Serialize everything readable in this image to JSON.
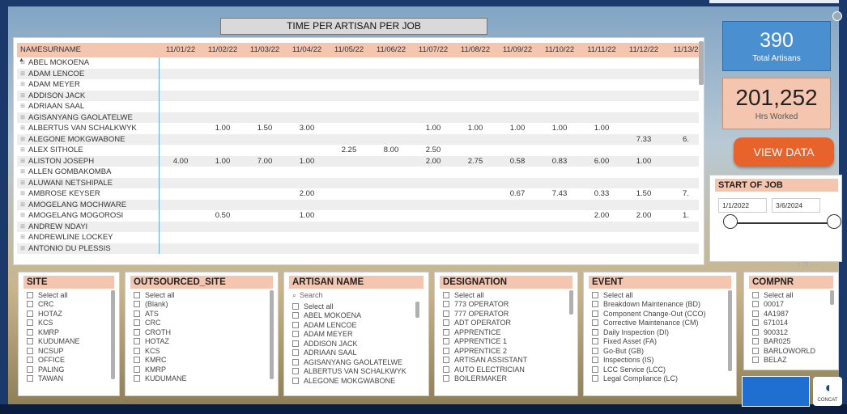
{
  "matrix": {
    "title": "TIME PER ARTISAN PER JOB",
    "name_header": "NAMESURNAME",
    "dates": [
      "11/01/22",
      "11/02/22",
      "11/03/22",
      "11/04/22",
      "11/05/22",
      "11/06/22",
      "11/07/22",
      "11/08/22",
      "11/09/22",
      "11/10/22",
      "11/11/22",
      "11/12/22",
      "11/13/2"
    ],
    "rows": [
      {
        "name": "ABEL MOKOENA",
        "cells": [
          "",
          "",
          "",
          "",
          "",
          "",
          "",
          "",
          "",
          "",
          "",
          "",
          ""
        ]
      },
      {
        "name": "ADAM LENCOE",
        "cells": [
          "",
          "",
          "",
          "",
          "",
          "",
          "",
          "",
          "",
          "",
          "",
          "",
          ""
        ]
      },
      {
        "name": "ADAM MEYER",
        "cells": [
          "",
          "",
          "",
          "",
          "",
          "",
          "",
          "",
          "",
          "",
          "",
          "",
          ""
        ]
      },
      {
        "name": "ADDISON JACK",
        "cells": [
          "",
          "",
          "",
          "",
          "",
          "",
          "",
          "",
          "",
          "",
          "",
          "",
          ""
        ]
      },
      {
        "name": "ADRIAAN SAAL",
        "cells": [
          "",
          "",
          "",
          "",
          "",
          "",
          "",
          "",
          "",
          "",
          "",
          "",
          ""
        ]
      },
      {
        "name": "AGISANYANG GAOLATELWE",
        "cells": [
          "",
          "",
          "",
          "",
          "",
          "",
          "",
          "",
          "",
          "",
          "",
          "",
          ""
        ]
      },
      {
        "name": "ALBERTUS VAN SCHALKWYK",
        "cells": [
          "",
          "1.00",
          "1.50",
          "3.00",
          "",
          "",
          "1.00",
          "1.00",
          "1.00",
          "1.00",
          "1.00",
          "",
          ""
        ]
      },
      {
        "name": "ALEGONE MOKGWABONE",
        "cells": [
          "",
          "",
          "",
          "",
          "",
          "",
          "",
          "",
          "",
          "",
          "",
          "7.33",
          "6."
        ]
      },
      {
        "name": "ALEX SITHOLE",
        "cells": [
          "",
          "",
          "",
          "",
          "2.25",
          "8.00",
          "2.50",
          "",
          "",
          "",
          "",
          "",
          ""
        ]
      },
      {
        "name": "ALISTON JOSEPH",
        "cells": [
          "4.00",
          "1.00",
          "7.00",
          "1.00",
          "",
          "",
          "2.00",
          "2.75",
          "0.58",
          "0.83",
          "6.00",
          "1.00",
          ""
        ]
      },
      {
        "name": "ALLEN GOMBAKOMBA",
        "cells": [
          "",
          "",
          "",
          "",
          "",
          "",
          "",
          "",
          "",
          "",
          "",
          "",
          ""
        ]
      },
      {
        "name": "ALUWANI NETSHIPALE",
        "cells": [
          "",
          "",
          "",
          "",
          "",
          "",
          "",
          "",
          "",
          "",
          "",
          "",
          ""
        ]
      },
      {
        "name": "AMBROSE KEYSER",
        "cells": [
          "",
          "",
          "",
          "2.00",
          "",
          "",
          "",
          "",
          "0.67",
          "7.43",
          "0.33",
          "1.50",
          "7."
        ]
      },
      {
        "name": "AMOGELANG MOCHWARE",
        "cells": [
          "",
          "",
          "",
          "",
          "",
          "",
          "",
          "",
          "",
          "",
          "",
          "",
          ""
        ]
      },
      {
        "name": "AMOGELANG MOGOROSI",
        "cells": [
          "",
          "0.50",
          "",
          "1.00",
          "",
          "",
          "",
          "",
          "",
          "",
          "2.00",
          "2.00",
          "1."
        ]
      },
      {
        "name": "ANDREW NDAYI",
        "cells": [
          "",
          "",
          "",
          "",
          "",
          "",
          "",
          "",
          "",
          "",
          "",
          "",
          ""
        ]
      },
      {
        "name": "ANDREWLINE LOCKEY",
        "cells": [
          "",
          "",
          "",
          "",
          "",
          "",
          "",
          "",
          "",
          "",
          "",
          "",
          ""
        ]
      },
      {
        "name": "ANTONIO DU PLESSIS",
        "cells": [
          "",
          "",
          "",
          "",
          "",
          "",
          "",
          "",
          "",
          "",
          "",
          "",
          ""
        ]
      }
    ]
  },
  "kpi": {
    "artisans_value": "390",
    "artisans_label": "Total Artisans",
    "hours_value": "201,252",
    "hours_label": "Hrs Worked"
  },
  "view_button": "VIEW DATA",
  "date_slicer": {
    "title": "START OF JOB",
    "start": "1/1/2022",
    "end": "3/6/2024"
  },
  "slicers": {
    "site": {
      "title": "SITE",
      "items": [
        "Select all",
        "CRC",
        "HOTAZ",
        "KCS",
        "KMRP",
        "KUDUMANE",
        "NCSUP",
        "OFFICE",
        "PALING",
        "TAWAN"
      ]
    },
    "outsourced": {
      "title": "OUTSOURCED_SITE",
      "items": [
        "Select all",
        "(Blank)",
        "ATS",
        "CRC",
        "CROTH",
        "HOTAZ",
        "KCS",
        "KMRC",
        "KMRP",
        "KUDUMANE"
      ]
    },
    "artisan": {
      "title": "ARTISAN NAME",
      "search_placeholder": "Search",
      "items": [
        "Select all",
        "ABEL MOKOENA",
        "ADAM LENCOE",
        "ADAM MEYER",
        "ADDISON JACK",
        "ADRIAAN SAAL",
        "AGISANYANG GAOLATELWE",
        "ALBERTUS VAN SCHALKWYK",
        "ALEGONE MOKGWABONE"
      ]
    },
    "designation": {
      "title": "DESIGNATION",
      "items": [
        "Select all",
        "773 OPERATOR",
        "777 OPERATOR",
        "ADT OPERATOR",
        "APPRENTICE",
        "APPRENTICE 1",
        "APPRENTICE 2",
        "ARTISAN ASSISTANT",
        "AUTO ELECTRICIAN",
        "BOILERMAKER"
      ]
    },
    "event": {
      "title": "EVENT",
      "items": [
        "Select all",
        "Breakdown Maintenance (BD)",
        "Component Change-Out (CCO)",
        "Corrective Maintenance (CM)",
        "Daily Inspection (DI)",
        "Fixed Asset (FA)",
        "Go-But (GB)",
        "Inspections (IS)",
        "LCC Service (LCC)",
        "Legal Compliance (LC)"
      ]
    },
    "compnr": {
      "title": "COMPNR",
      "items": [
        "Select all",
        "00017",
        "4A1987",
        "671014",
        "900312",
        "BAR025",
        "BARLOWORLD",
        "BELAZ"
      ]
    }
  },
  "logo_text": "CONCAT"
}
